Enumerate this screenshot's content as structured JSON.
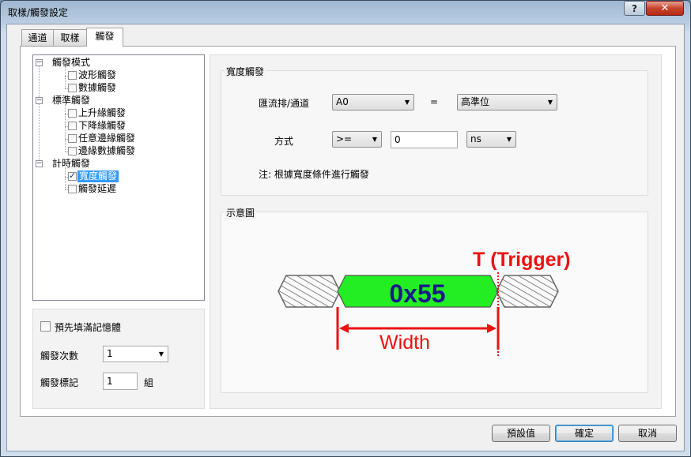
{
  "window": {
    "title": "取樣/觸發設定",
    "help": "?",
    "close": "✕"
  },
  "tabs": [
    {
      "label": "通道"
    },
    {
      "label": "取樣"
    },
    {
      "label": "觸發"
    }
  ],
  "tree": {
    "groups": [
      {
        "label": "觸發模式",
        "items": [
          {
            "label": "波形觸發",
            "checked": false
          },
          {
            "label": "數據觸發",
            "checked": false
          }
        ]
      },
      {
        "label": "標準觸發",
        "items": [
          {
            "label": "上升緣觸發",
            "checked": false
          },
          {
            "label": "下降緣觸發",
            "checked": false
          },
          {
            "label": "任意邊緣觸發",
            "checked": false
          },
          {
            "label": "邊緣數據觸發",
            "checked": false
          }
        ]
      },
      {
        "label": "計時觸發",
        "items": [
          {
            "label": "寬度觸發",
            "checked": true,
            "selected": true
          },
          {
            "label": "觸發延遲",
            "checked": false
          }
        ]
      }
    ]
  },
  "left_options": {
    "prefill_label": "預先填滿記憶體",
    "count_label": "觸發次數",
    "count_value": "1",
    "mark_label": "觸發標記",
    "mark_value": "1",
    "mark_unit": "組"
  },
  "width_trigger": {
    "group_title": "寬度觸發",
    "bus_label": "匯流排/通道",
    "bus_value": "A0",
    "equals": "=",
    "level_value": "高準位",
    "mode_label": "方式",
    "op_value": ">=",
    "amount_value": "0",
    "unit_value": "ns",
    "note": "注: 根據寬度條件進行觸發"
  },
  "diagram": {
    "group_title": "示意圖",
    "trigger_label": "T (Trigger)",
    "data_label": "0x55",
    "width_label": "Width",
    "colors": {
      "data_fill": "#22ee22",
      "data_text": "#1a1a8c",
      "marker": "#ee1111"
    }
  },
  "buttons": {
    "defaults": "預設值",
    "ok": "確定",
    "cancel": "取消"
  }
}
